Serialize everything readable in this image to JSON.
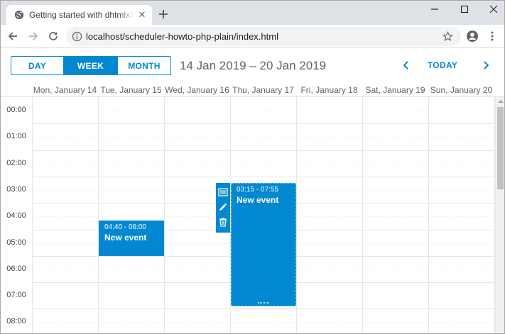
{
  "browser": {
    "tab_title": "Getting started with dhtmlxScheduler",
    "url": "localhost/scheduler-howto-php-plain/index.html"
  },
  "scheduler": {
    "views": {
      "day": "DAY",
      "week": "WEEK",
      "month": "MONTH",
      "active": "WEEK"
    },
    "date_range": "14 Jan 2019 – 20 Jan 2019",
    "today_label": "TODAY",
    "days": [
      "Mon, January 14",
      "Tue, January 15",
      "Wed, January 16",
      "Thu, January 17",
      "Fri, January 18",
      "Sat, January 19",
      "Sun, January 20"
    ],
    "hours": [
      "00:00",
      "01:00",
      "02:00",
      "03:00",
      "04:00",
      "05:00",
      "06:00",
      "07:00",
      "08:00"
    ],
    "events": [
      {
        "day_index": 1,
        "start": "04:40",
        "end": "06:00",
        "time_label": "04:40 - 06:00",
        "text": "New event",
        "selected": false
      },
      {
        "day_index": 3,
        "start": "03:15",
        "end": "07:55",
        "time_label": "03:15 - 07:55",
        "text": "New event",
        "selected": true
      }
    ],
    "event_menu_icons": [
      "details-icon",
      "edit-icon",
      "delete-icon"
    ],
    "accent_color": "#0288d1"
  }
}
